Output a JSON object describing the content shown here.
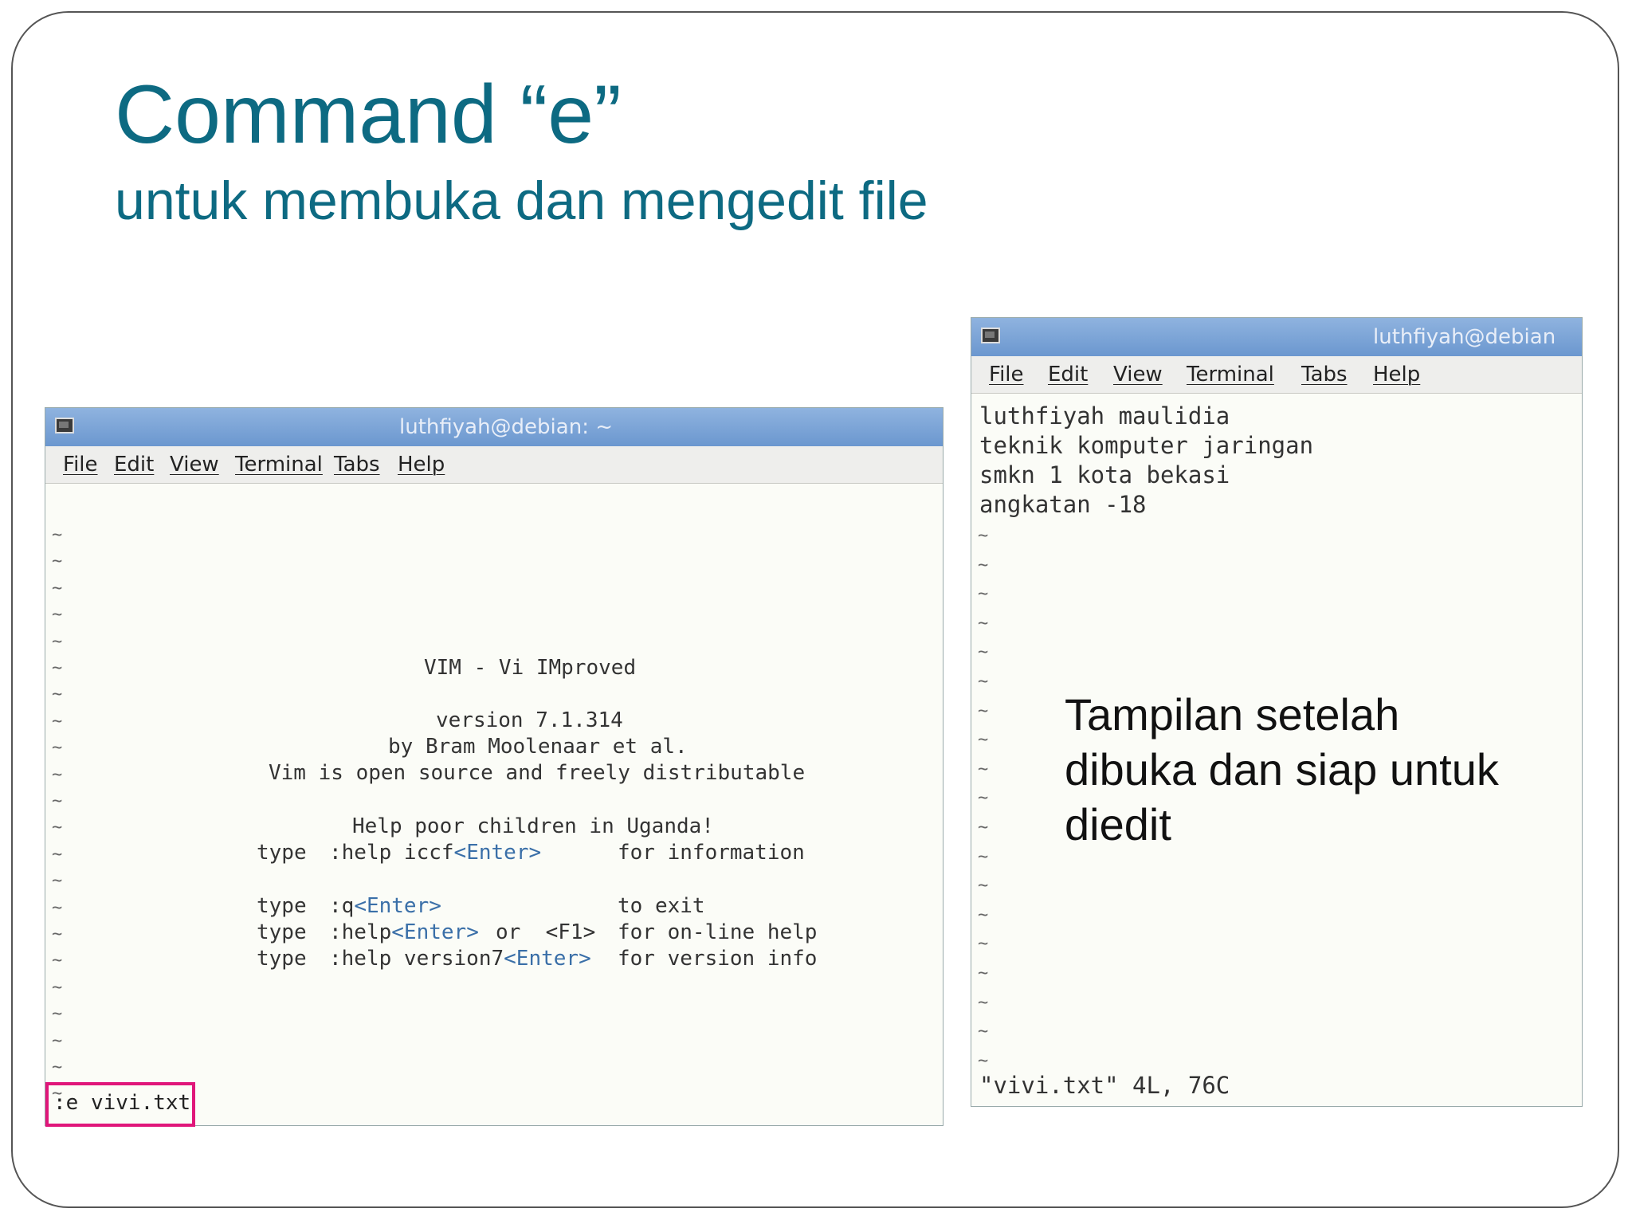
{
  "slide": {
    "title": "Command “e”",
    "subtitle": "untuk membuka dan mengedit file",
    "caption_lines": [
      "Tampilan setelah",
      "dibuka dan siap untuk",
      "diedit"
    ]
  },
  "left_terminal": {
    "window_title": "luthfiyah@debian: ~",
    "menu": [
      "File",
      "Edit",
      "View",
      "Terminal",
      "Tabs",
      "Help"
    ],
    "splash": {
      "name_line": "VIM - Vi IMproved",
      "version_line": "version 7.1.314",
      "author_line": "by Bram Moolenaar et al.",
      "license_line": "Vim is open source and freely distributable",
      "help_line": "Help poor children in Uganda!",
      "rows": [
        {
          "type": "type",
          "cmd": ":help iccf",
          "key": "<Enter>",
          "extra": "",
          "desc": "for information"
        },
        {
          "type": "type",
          "cmd": ":q",
          "key": "<Enter>",
          "extra": "",
          "desc": "to exit"
        },
        {
          "type": "type",
          "cmd": ":help",
          "key": "<Enter>",
          "extra": "or  <F1>",
          "desc": "for on-line help"
        },
        {
          "type": "type",
          "cmd": ":help version7",
          "key": "<Enter>",
          "extra": "",
          "desc": "for version info"
        }
      ]
    },
    "command_line": ":e vivi.txt",
    "tilde": "~"
  },
  "right_terminal": {
    "window_title": "luthfiyah@debian",
    "menu": [
      "File",
      "Edit",
      "View",
      "Terminal",
      "Tabs",
      "Help"
    ],
    "file_lines": [
      "luthfiyah maulidia",
      "teknik komputer jaringan",
      "smkn 1 kota bekasi",
      "angkatan -18"
    ],
    "status_line": "\"vivi.txt\" 4L, 76C",
    "tilde": "~"
  },
  "colors": {
    "title": "#0d6a82",
    "highlight_box": "#e0167a",
    "vim_key": "#3a6fa8"
  }
}
